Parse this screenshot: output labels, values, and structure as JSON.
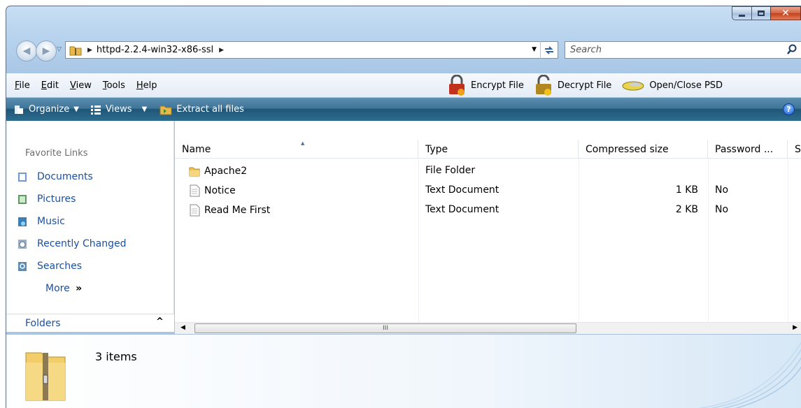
{
  "window": {
    "caption_buttons": {
      "minimize": "minimize",
      "maximize": "maximize",
      "close": "x"
    }
  },
  "address": {
    "path": "httpd-2.2.4-win32-x86-ssl",
    "search_placeholder": "Search"
  },
  "menu": {
    "items": [
      {
        "label": "File",
        "accel": "F"
      },
      {
        "label": "Edit",
        "accel": "E"
      },
      {
        "label": "View",
        "accel": "V"
      },
      {
        "label": "Tools",
        "accel": "T"
      },
      {
        "label": "Help",
        "accel": "H"
      }
    ],
    "tools": {
      "encrypt": "Encrypt File",
      "decrypt": "Decrypt File",
      "open_close": "Open/Close PSD"
    }
  },
  "commandbar": {
    "organize": "Organize",
    "views": "Views",
    "extract": "Extract all files",
    "help": "?"
  },
  "navpane": {
    "heading": "Favorite Links",
    "links": [
      {
        "label": "Documents",
        "icon": "documents-icon"
      },
      {
        "label": "Pictures",
        "icon": "pictures-icon"
      },
      {
        "label": "Music",
        "icon": "music-icon"
      },
      {
        "label": "Recently Changed",
        "icon": "recently-changed-icon"
      },
      {
        "label": "Searches",
        "icon": "searches-icon"
      }
    ],
    "more": "More",
    "more_glyph": "»",
    "folders": "Folders"
  },
  "columns": [
    "Name",
    "Type",
    "Compressed size",
    "Password ...",
    "S"
  ],
  "files": [
    {
      "name": "Apache2",
      "type": "File Folder",
      "size": "",
      "password": "",
      "icon": "folder-icon"
    },
    {
      "name": "Notice",
      "type": "Text Document",
      "size": "1 KB",
      "password": "No",
      "icon": "text-document-icon"
    },
    {
      "name": "Read Me First",
      "type": "Text Document",
      "size": "2 KB",
      "password": "No",
      "icon": "text-document-icon"
    }
  ],
  "scrollbar": {
    "grip": "III"
  },
  "details": {
    "count": "3 items"
  }
}
